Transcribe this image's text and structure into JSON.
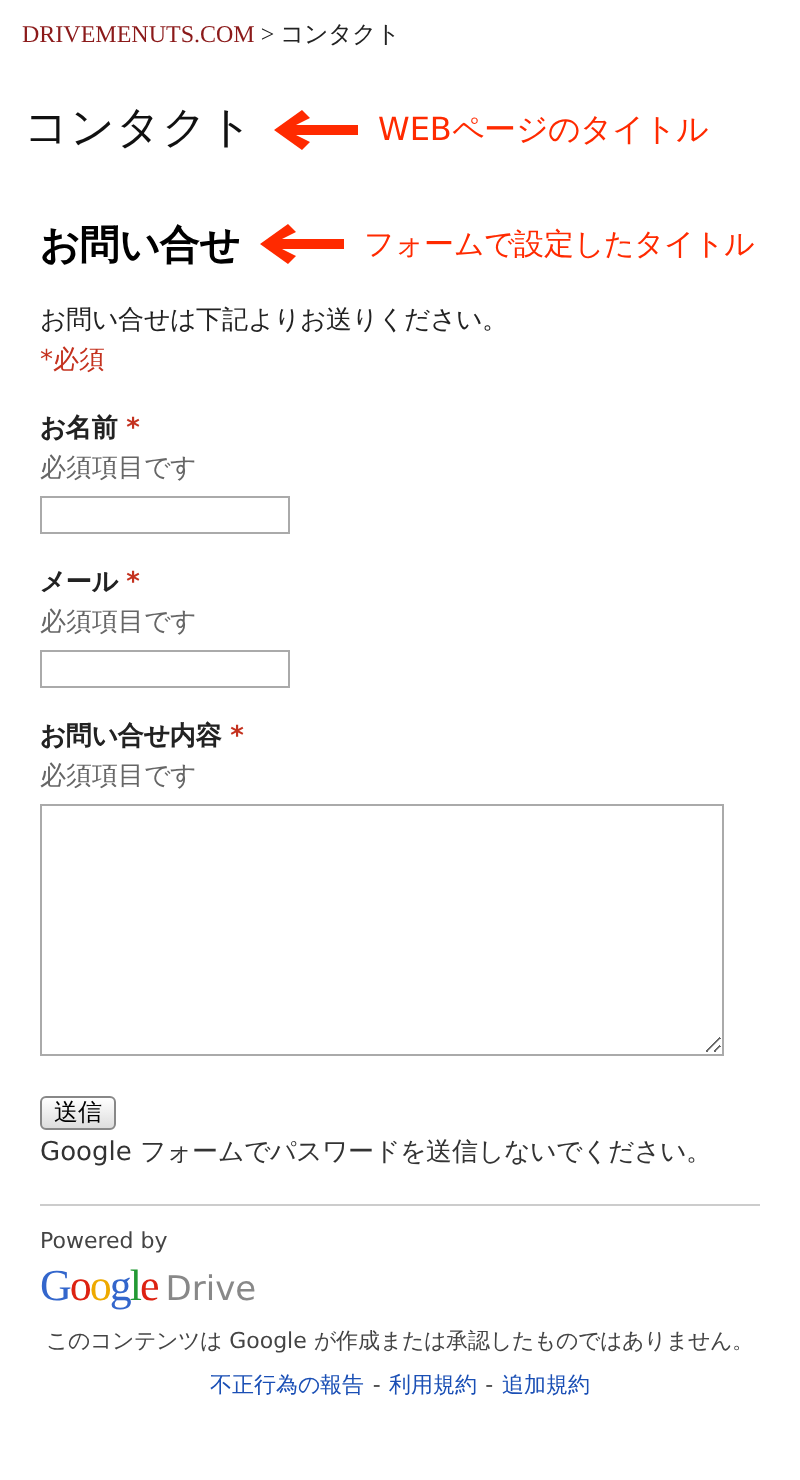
{
  "breadcrumb": {
    "site": "DRIVEMENUTS.COM",
    "separator": ">",
    "current": "コンタクト"
  },
  "page_title": {
    "text": "コンタクト",
    "annotation": "WEBページのタイトル"
  },
  "form_title": {
    "text": "お問い合せ",
    "annotation": "フォームで設定したタイトル"
  },
  "description": "お問い合せは下記よりお送りください。",
  "required_note": "*必須",
  "fields": [
    {
      "kind": "text",
      "label": "お名前",
      "required_mark": "*",
      "help": "必須項目です"
    },
    {
      "kind": "text",
      "label": "メール",
      "required_mark": "*",
      "help": "必須項目です"
    },
    {
      "kind": "textarea",
      "label": "お問い合せ内容",
      "required_mark": "*",
      "help": "必須項目です"
    }
  ],
  "submit_button": "送信",
  "password_warning": "Google フォームでパスワードを送信しないでください。",
  "footer": {
    "powered_by": "Powered by",
    "logo": "Google",
    "product": "Drive",
    "disclaimer": "このコンテンツは Google が作成または承認したものではありません。",
    "links": [
      "不正行為の報告",
      "利用規約",
      "追加規約"
    ],
    "link_separator": "-"
  }
}
